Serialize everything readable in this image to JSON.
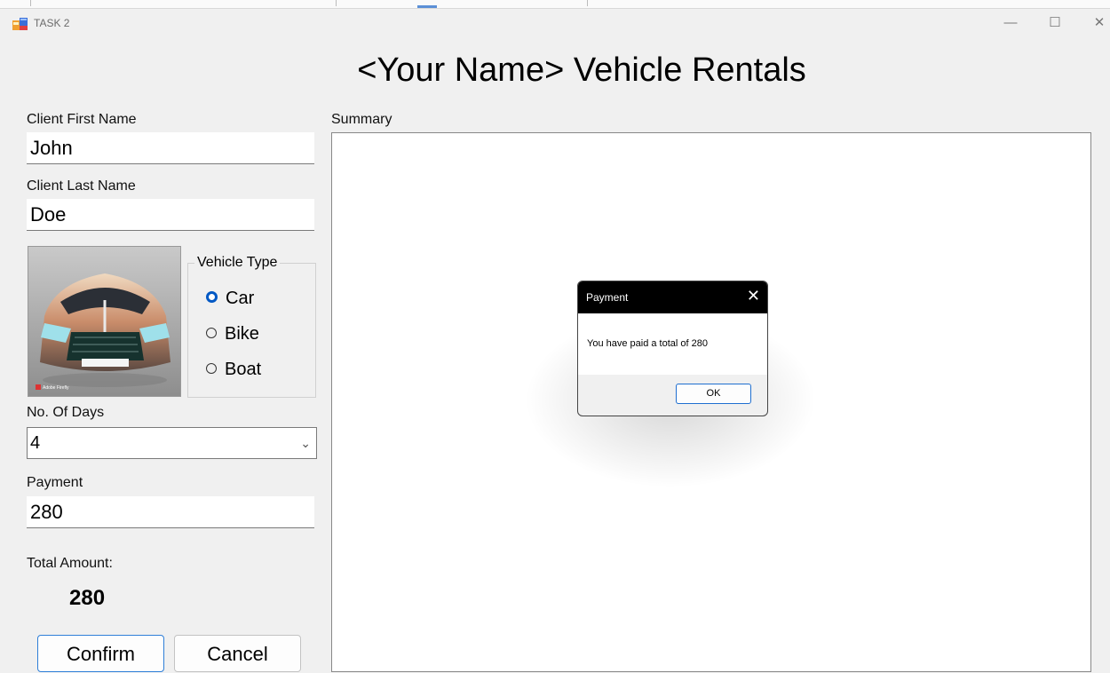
{
  "window": {
    "title": "TASK 2",
    "minimize_glyph": "—",
    "maximize_glyph": "☐",
    "close_glyph": "✕"
  },
  "heading": "<Your Name> Vehicle Rentals",
  "form": {
    "first_name_label": "Client First Name",
    "first_name_value": "John",
    "last_name_label": "Client Last Name",
    "last_name_value": "Doe",
    "vehicle_type": {
      "title": "Vehicle Type",
      "options": [
        {
          "label": "Car",
          "selected": true
        },
        {
          "label": "Bike",
          "selected": false
        },
        {
          "label": "Boat",
          "selected": false
        }
      ]
    },
    "days_label": "No. Of Days",
    "days_value": "4",
    "payment_label": "Payment",
    "payment_value": "280",
    "total_label": "Total Amount:",
    "total_value": "280",
    "confirm_label": "Confirm",
    "cancel_label": "Cancel"
  },
  "summary": {
    "label": "Summary"
  },
  "dialog": {
    "title": "Payment",
    "message": "You have paid a total of 280",
    "ok_label": "OK",
    "close_glyph": "✕"
  },
  "image": {
    "subject": "car-photo",
    "watermark": "Adobe Firefly"
  },
  "colors": {
    "accent": "#0058c4",
    "background": "#f0f0f0",
    "dialog_titlebar": "#000000"
  }
}
